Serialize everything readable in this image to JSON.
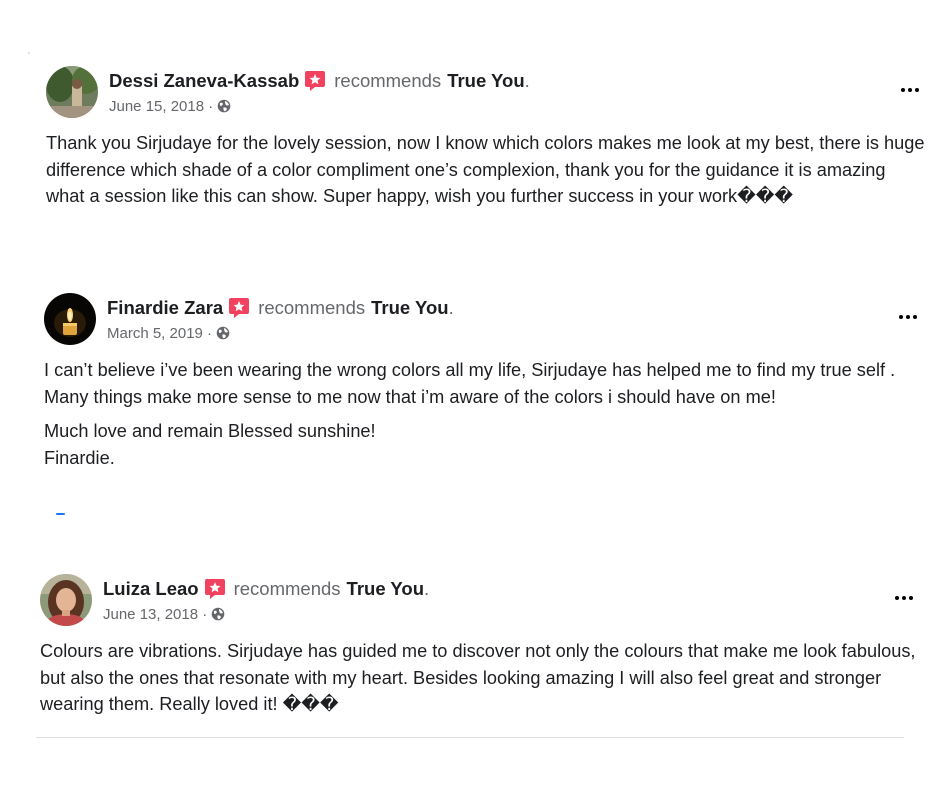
{
  "reviews": [
    {
      "name": "Dessi Zaneva-Kassab",
      "recommends": "recommends",
      "page": "True You",
      "period": ".",
      "date": "June 15, 2018 ·",
      "paragraphs": [
        "Thank you Sirjudaye for the lovely session, now I know which colors makes me look at my best, there is huge difference which shade of a color compliment one’s complexion, thank you for the guidance it is amazing what a session like this can show. Super happy, wish you further success in your work���"
      ]
    },
    {
      "name": "Finardie Zara",
      "recommends": "recommends",
      "page": "True You",
      "period": ".",
      "date": "March 5, 2019 ·",
      "paragraphs": [
        "I can’t believe i’ve been wearing the wrong colors all my life, Sirjudaye has helped me to find my true self . Many things make more sense to me now that i’m aware of the colors i should have on me!",
        "Much love and remain Blessed sunshine!",
        "Finardie."
      ]
    },
    {
      "name": "Luiza Leao",
      "recommends": "recommends",
      "page": "True You",
      "period": ".",
      "date": "June 13, 2018 ·",
      "paragraphs": [
        "Colours are vibrations. Sirjudaye has guided me to discover not only the colours that make me look fabulous, but also the ones that resonate with my heart. Besides looking amazing I will also feel great and stronger wearing them. Really loved it! ���"
      ]
    }
  ],
  "icons": {
    "recommend": "recommend-star-icon",
    "privacy": "globe-icon",
    "more": "more-options-icon"
  },
  "colors": {
    "recommend_badge": "#f3425f",
    "secondary_text": "#65676b",
    "primary_text": "#1c1e21",
    "link_blue": "#1877f2"
  }
}
